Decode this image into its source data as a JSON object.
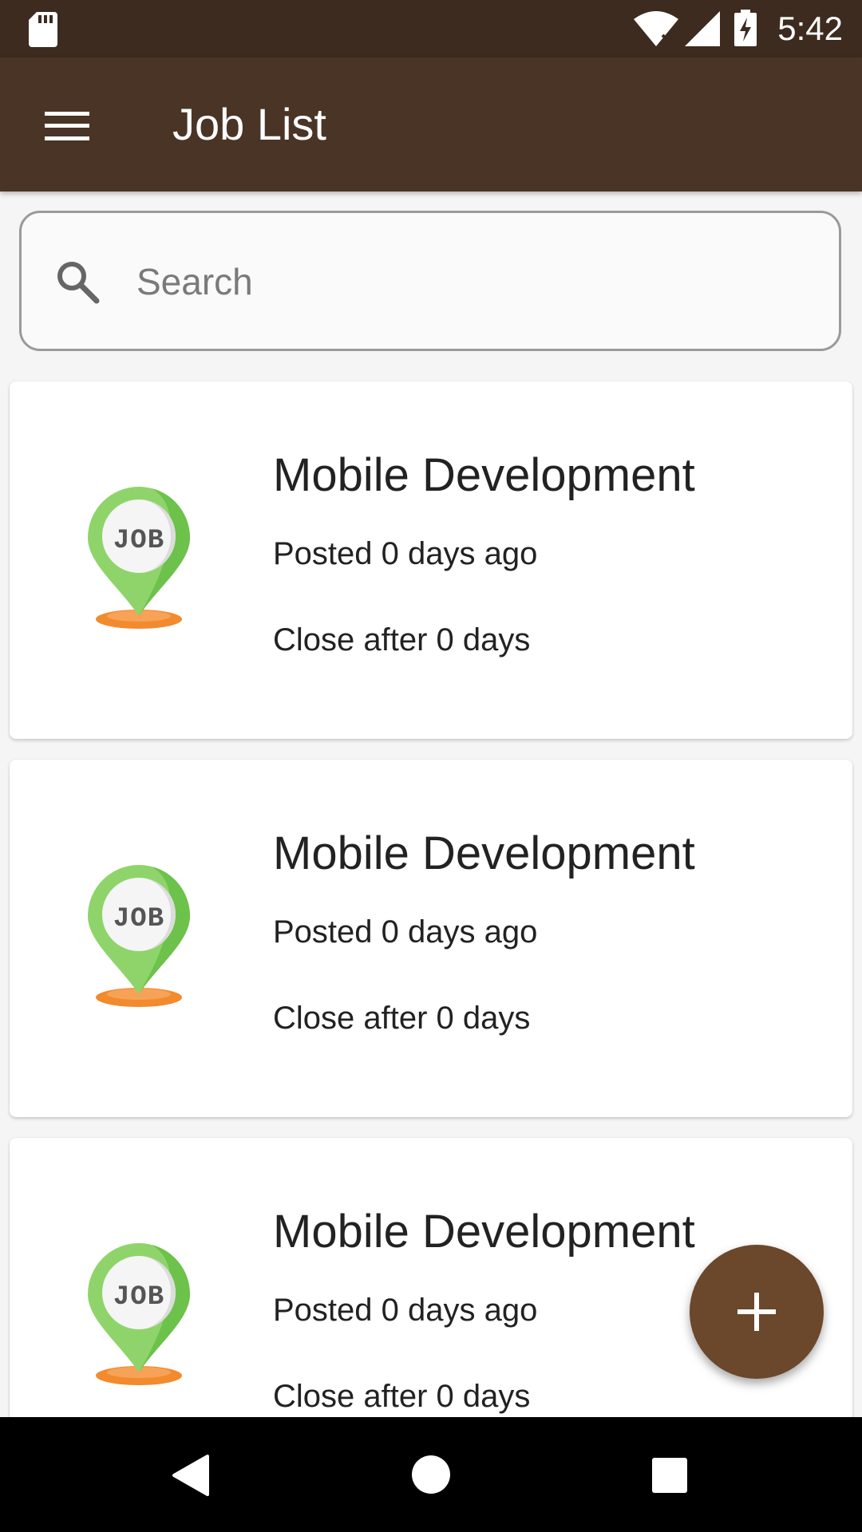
{
  "status_bar": {
    "time": "5:42",
    "icons": [
      "sd-card-icon",
      "wifi-icon",
      "signal-icon",
      "battery-charging-icon"
    ]
  },
  "app_bar": {
    "title": "Job List",
    "menu_icon": "hamburger-menu-icon"
  },
  "search": {
    "placeholder": "Search",
    "value": "",
    "icon": "search-icon"
  },
  "jobs": [
    {
      "title": "Mobile Development",
      "posted": "Posted 0 days ago",
      "close": "Close after 0 days",
      "logo_text": "JOB"
    },
    {
      "title": "Mobile Development",
      "posted": "Posted 0 days ago",
      "close": "Close after 0 days",
      "logo_text": "JOB"
    },
    {
      "title": "Mobile Development",
      "posted": "Posted 0 days ago",
      "close": "Close after 0 days",
      "logo_text": "JOB"
    }
  ],
  "fab": {
    "icon": "plus-icon"
  },
  "nav_bar": {
    "icons": [
      "back-icon",
      "home-icon",
      "recents-icon"
    ]
  },
  "colors": {
    "status_bar": "#3d2b1f",
    "app_bar": "#4a3426",
    "fab": "#6b472b",
    "background": "#f5f5f5",
    "pin_green": "#8fd46a",
    "pin_shadow": "#f28a2e"
  }
}
